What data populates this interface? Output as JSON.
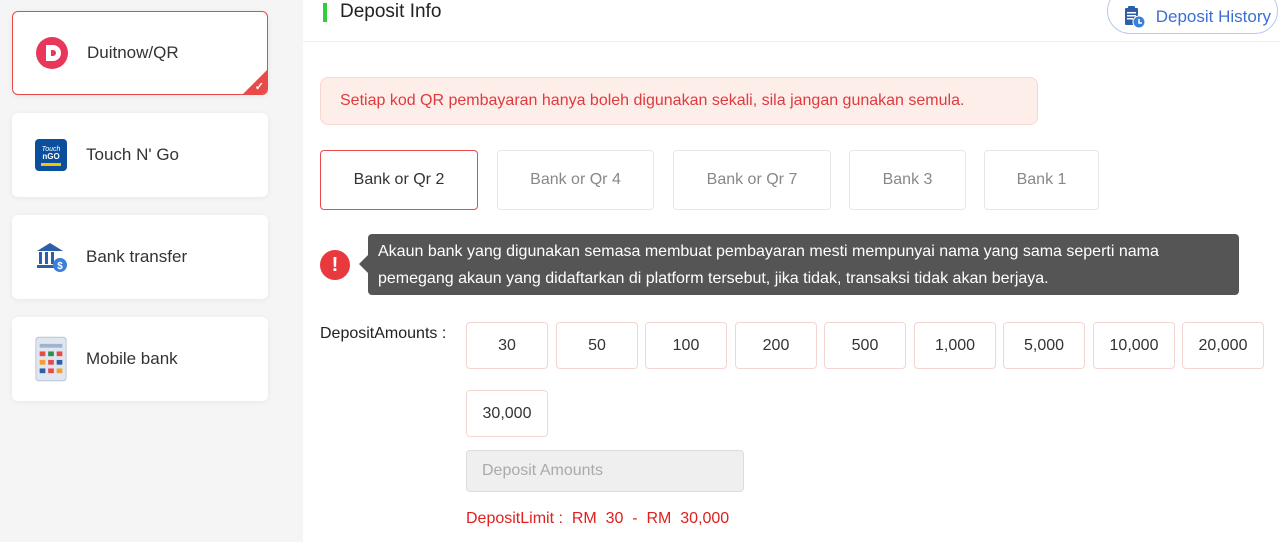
{
  "sidebar": {
    "methods": [
      {
        "label": "Duitnow/QR",
        "icon": "duitnow-icon",
        "active": true
      },
      {
        "label": "Touch N' Go",
        "icon": "touchngo-icon",
        "active": false
      },
      {
        "label": "Bank transfer",
        "icon": "bank-icon",
        "active": false
      },
      {
        "label": "Mobile bank",
        "icon": "mobile-bank-icon",
        "active": false
      }
    ],
    "check_mark": "✓"
  },
  "header": {
    "title": "Deposit Info",
    "history_label": "Deposit History"
  },
  "notice": "Setiap kod QR pembayaran hanya boleh digunakan sekali, sila jangan gunakan semula.",
  "channels": [
    {
      "label": "Bank or Qr 2",
      "selected": true
    },
    {
      "label": "Bank or Qr 4",
      "selected": false
    },
    {
      "label": "Bank or Qr 7",
      "selected": false
    },
    {
      "label": "Bank 3",
      "selected": false
    },
    {
      "label": "Bank 1",
      "selected": false
    }
  ],
  "warning": {
    "icon_text": "!",
    "tooltip_line1": "Akaun bank yang digunakan semasa membuat pembayaran mesti mempunyai nama yang sama seperti nama",
    "tooltip_line2": "pemegang akaun yang didaftarkan di platform tersebut, jika tidak, transaksi tidak akan berjaya."
  },
  "amounts": {
    "label": "DepositAmounts :",
    "options": [
      "30",
      "50",
      "100",
      "200",
      "500",
      "1,000",
      "5,000",
      "10,000",
      "20,000",
      "30,000"
    ],
    "input_placeholder": "Deposit Amounts",
    "input_value": "",
    "limit_text": "DepositLimit :  RM  30  -  RM  30,000"
  },
  "colors": {
    "accent_red": "#e84a4a",
    "accent_green": "#2fcf3a",
    "link_blue": "#3d6fd1"
  }
}
